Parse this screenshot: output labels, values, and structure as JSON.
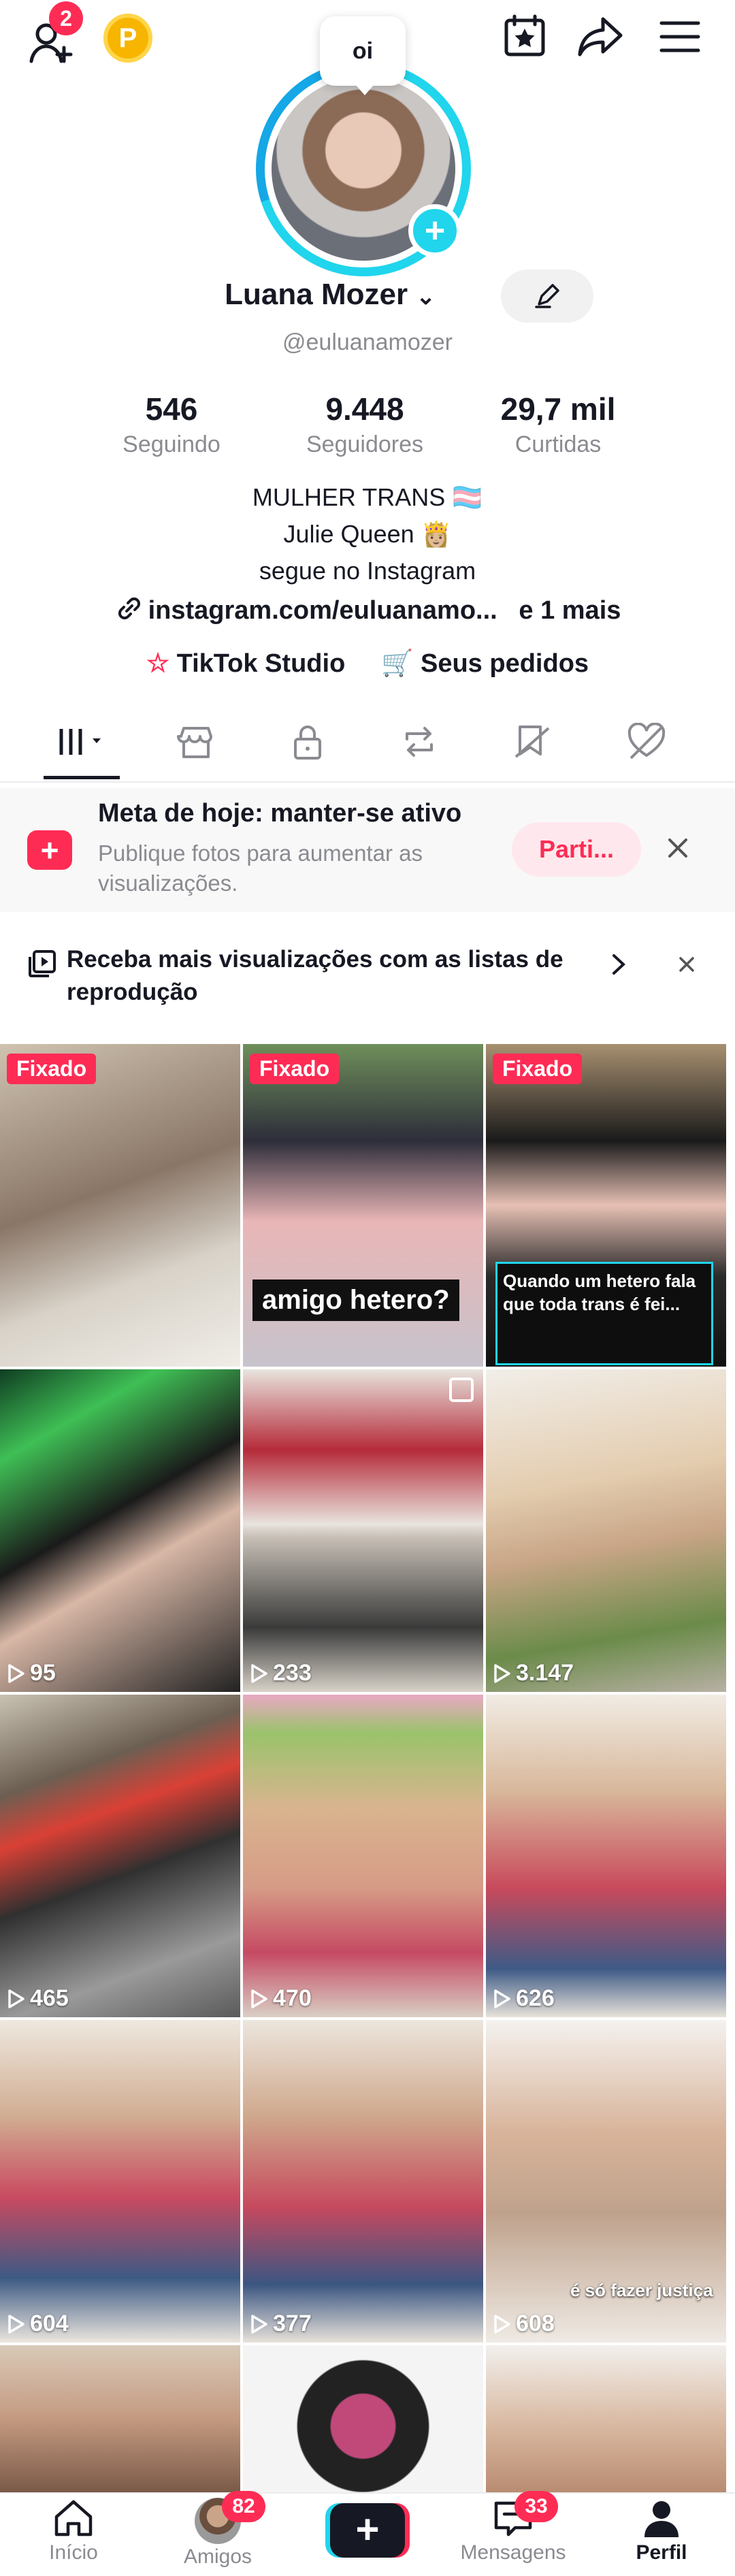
{
  "topbar": {
    "friends_badge": "2",
    "coin_letter": "P"
  },
  "profile": {
    "status_bubble": "oi",
    "name": "Luana Mozer",
    "handle": "@euluanamozer",
    "stats": [
      {
        "value": "546",
        "label": "Seguindo"
      },
      {
        "value": "9.448",
        "label": "Seguidores"
      },
      {
        "value": "29,7 mil",
        "label": "Curtidas"
      }
    ],
    "bio": [
      "MULHER TRANS 🏳️‍⚧️",
      "Julie Queen 👸🏼",
      "segue no Instagram"
    ],
    "link": "instagram.com/euluanamo...",
    "link_more": "e 1 mais",
    "studio_label": "TikTok Studio",
    "orders_label": "Seus pedidos"
  },
  "goal_banner": {
    "title": "Meta de hoje: manter-se ativo",
    "subtitle": "Publique fotos para aumentar as visualizações.",
    "button": "Parti..."
  },
  "playlist_banner": {
    "text": "Receba mais visualizações com as listas de reprodução"
  },
  "grid": {
    "pinned_label": "Fixado",
    "captions": {
      "c1": "amigo hetero?",
      "c2": "Quando um hetero fala que toda trans é fei...",
      "c3": "é só fazer justiça"
    },
    "views": [
      "95",
      "233",
      "3.147",
      "465",
      "470",
      "626",
      "604",
      "377",
      "608"
    ]
  },
  "nav": {
    "home": "Início",
    "friends": "Amigos",
    "friends_badge": "82",
    "messages": "Mensagens",
    "messages_badge": "33",
    "profile": "Perfil"
  }
}
